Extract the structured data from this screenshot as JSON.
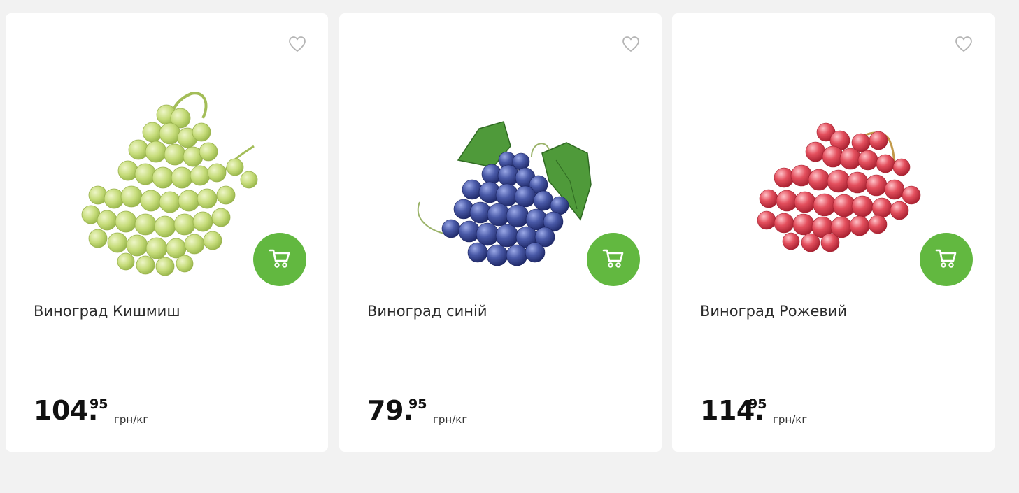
{
  "colors": {
    "page_bg": "#f2f2f2",
    "card_bg": "#ffffff",
    "accent_green": "#62b840",
    "text": "#2b2b2b"
  },
  "products": [
    {
      "name": "Виноград Кишмиш",
      "price_main": "104.",
      "price_cents": "95",
      "unit": "грн/кг",
      "fav_icon": "heart-outline-icon",
      "cart_icon": "cart-icon",
      "image": "green-grapes"
    },
    {
      "name": "Виноград синій",
      "price_main": "79.",
      "price_cents": "95",
      "unit": "грн/кг",
      "fav_icon": "heart-outline-icon",
      "cart_icon": "cart-icon",
      "image": "blue-grapes"
    },
    {
      "name": "Виноград Рожевий",
      "price_main": "114.",
      "price_cents": "95",
      "unit": "грн/кг",
      "fav_icon": "heart-outline-icon",
      "cart_icon": "cart-icon",
      "image": "pink-grapes"
    }
  ]
}
